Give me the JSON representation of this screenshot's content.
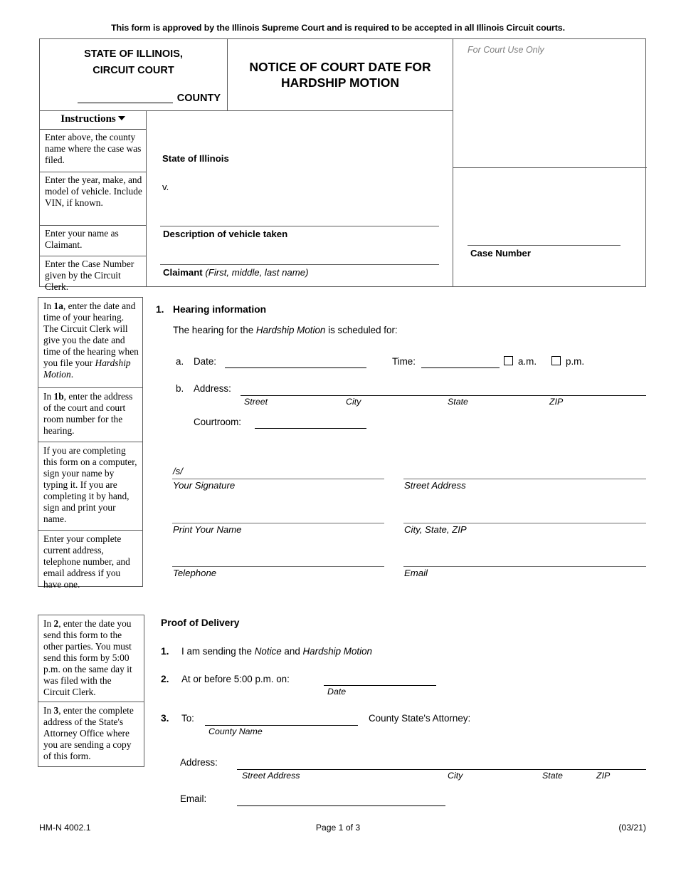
{
  "approval_note": "This form is approved by the Illinois Supreme Court and is required to be accepted in all Illinois Circuit courts.",
  "header": {
    "state_line1": "STATE OF ILLINOIS,",
    "state_line2": "CIRCUIT COURT",
    "county_label": "COUNTY",
    "form_title": "NOTICE OF COURT DATE FOR HARDSHIP MOTION",
    "court_use_label": "For Court Use Only",
    "case_number_label": "Case Number",
    "instructions_title": "Instructions",
    "instructions": [
      "Enter above, the county name where the case was filed.",
      "Enter the year, make, and model of vehicle. Include VIN, if known.",
      "Enter your name as Claimant.",
      "Enter the Case Number given by the Circuit Clerk."
    ],
    "caption": {
      "plaintiff": "State of Illinois",
      "versus": "v.",
      "vehicle_label": "Description of vehicle taken",
      "claimant_label": "Claimant",
      "claimant_hint": "(First, middle, last name)"
    }
  },
  "notes_group_1": [
    "In 1a, enter the date and time of your hearing.\nThe Circuit Clerk will give you the date and time of the hearing when you file your Hardship Motion.",
    "In 1b, enter the address of the court and court room number for the hearing.",
    "If you are completing this form on a computer, sign your name by typing it. If you are completing it by hand, sign and print your name.",
    "Enter your complete current address, telephone number, and email address if you have one."
  ],
  "notes_group_2": [
    "In 2, enter the date you send this form to the other parties. You must send this form by 5:00 p.m. on the same day it was filed with the Circuit Clerk.",
    "In 3, enter the complete address of the State's Attorney Office where you are sending a copy of this form."
  ],
  "section1": {
    "number": "1.",
    "title": "Hearing information",
    "intro_pre": "The hearing for the ",
    "intro_em": "Hardship Motion",
    "intro_post": " is scheduled for:",
    "item_a": "a.",
    "date_label": "Date:",
    "time_label": "Time:",
    "am_label": "a.m.",
    "pm_label": "p.m.",
    "item_b": "b.",
    "address_label": "Address:",
    "address_hints": [
      "Street",
      "City",
      "State",
      "ZIP"
    ],
    "courtroom_label": "Courtroom:"
  },
  "signature": {
    "s_mark": "/s/",
    "your_signature": "Your Signature",
    "print_your_name": "Print Your Name",
    "telephone": "Telephone",
    "street_address": "Street Address",
    "city_state_zip": "City, State, ZIP",
    "email": "Email"
  },
  "proof": {
    "title": "Proof of Delivery",
    "item1_num": "1.",
    "item1_pre": "I am sending the ",
    "item1_em1": "Notice",
    "item1_mid": " and ",
    "item1_em2": "Hardship Motion",
    "item2_num": "2.",
    "item2_text": "At or before 5:00 p.m. on:",
    "item2_hint": "Date",
    "item3_num": "3.",
    "item3_to": "To:",
    "item3_hint": "County Name",
    "item3_suffix": "County State's Attorney:",
    "address_label": "Address:",
    "address_hints": [
      "Street Address",
      "City",
      "State",
      "ZIP"
    ],
    "email_label": "Email:"
  },
  "footer": {
    "form_id": "HM-N 4002.1",
    "page": "Page 1 of 3",
    "revision": "(03/21)"
  }
}
